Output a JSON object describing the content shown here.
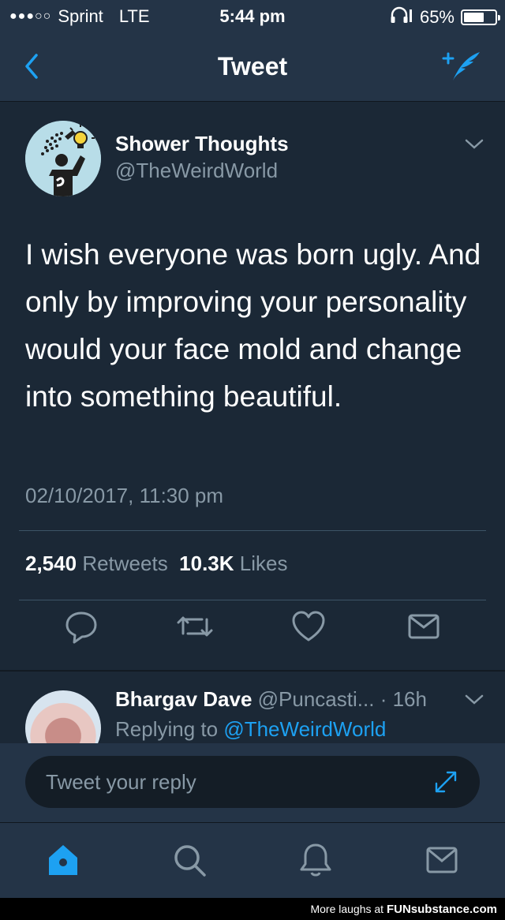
{
  "status_bar": {
    "signal": "●●●○○",
    "carrier": "Sprint",
    "network": "LTE",
    "time": "5:44 pm",
    "battery": "65%",
    "battery_level": 0.65
  },
  "nav": {
    "title": "Tweet",
    "accent": "#1da1f2"
  },
  "tweet": {
    "display_name": "Shower Thoughts",
    "handle": "@TheWeirdWorld",
    "text": "I wish everyone was born ugly. And only by improving your personality would your face mold and change into something beautiful.",
    "timestamp": "02/10/2017, 11:30 pm",
    "retweets_count": "2,540",
    "retweets_label": "Retweets",
    "likes_count": "10.3K",
    "likes_label": "Likes"
  },
  "reply": {
    "display_name": "Bhargav Dave",
    "handle": "@Puncasti...",
    "time": "· 16h",
    "replying_to_label": "Replying to",
    "replying_to_handle": "@TheWeirdWorld"
  },
  "composer": {
    "placeholder": "Tweet your reply"
  },
  "footer": {
    "prefix": "More laughs at",
    "brand": "FUNsubstance.com"
  },
  "colors": {
    "background": "#141d26",
    "card": "#1b2836",
    "bar": "#243447",
    "secondary_text": "#8899a6",
    "link": "#1da1f2"
  }
}
